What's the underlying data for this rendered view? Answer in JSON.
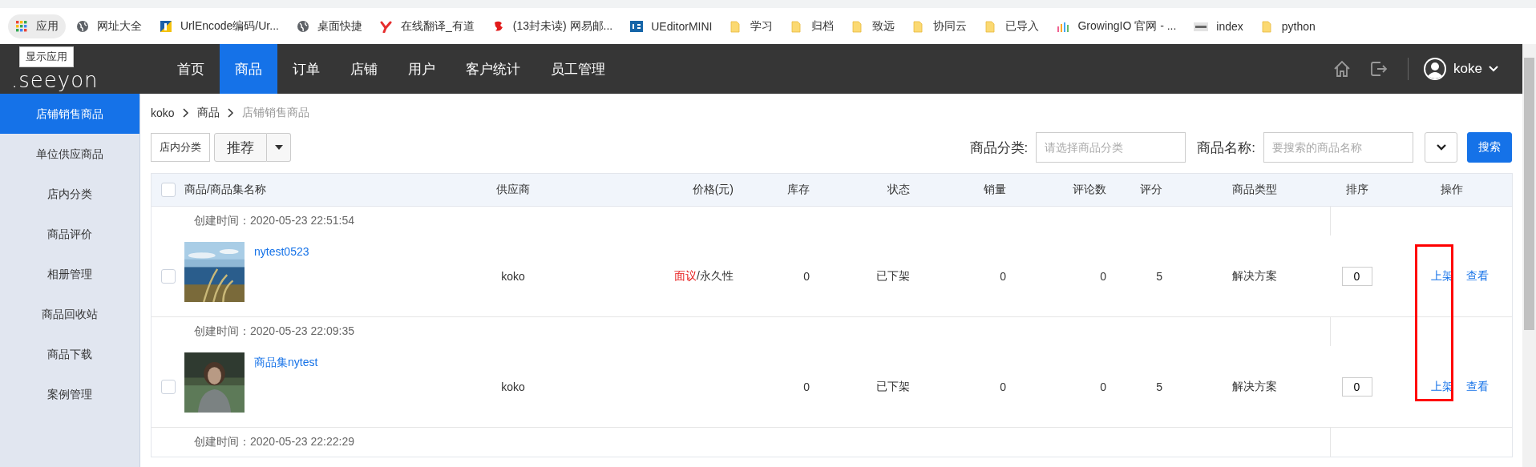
{
  "bookmarks": [
    {
      "label": "应用",
      "kind": "apps"
    },
    {
      "label": "网址大全",
      "kind": "globe"
    },
    {
      "label": "UrlEncode编码/Ur...",
      "kind": "encode"
    },
    {
      "label": "桌面快捷",
      "kind": "globe"
    },
    {
      "label": "在线翻译_有道",
      "kind": "youdao"
    },
    {
      "label": "(13封未读) 网易邮...",
      "kind": "mail"
    },
    {
      "label": "UEditorMINI",
      "kind": "ue"
    },
    {
      "label": "学习",
      "kind": "folder"
    },
    {
      "label": "归档",
      "kind": "folder"
    },
    {
      "label": "致远",
      "kind": "folder"
    },
    {
      "label": "协同云",
      "kind": "folder"
    },
    {
      "label": "已导入",
      "kind": "folder"
    },
    {
      "label": "GrowingIO 官网 - ...",
      "kind": "bars"
    },
    {
      "label": "index",
      "kind": "tile"
    },
    {
      "label": "python",
      "kind": "folder"
    }
  ],
  "header": {
    "logo": ".seeyon",
    "tooltip": "显示应用",
    "nav": [
      {
        "label": "首页",
        "selected": false
      },
      {
        "label": "商品",
        "selected": true
      },
      {
        "label": "订单",
        "selected": false
      },
      {
        "label": "店铺",
        "selected": false
      },
      {
        "label": "用户",
        "selected": false
      },
      {
        "label": "客户统计",
        "selected": false
      },
      {
        "label": "员工管理",
        "selected": false
      }
    ],
    "user": "koke"
  },
  "sidebar": {
    "items": [
      {
        "label": "店铺销售商品",
        "selected": true
      },
      {
        "label": "单位供应商品",
        "selected": false
      },
      {
        "label": "店内分类",
        "selected": false
      },
      {
        "label": "商品评价",
        "selected": false
      },
      {
        "label": "相册管理",
        "selected": false
      },
      {
        "label": "商品回收站",
        "selected": false
      },
      {
        "label": "商品下载",
        "selected": false
      },
      {
        "label": "案例管理",
        "selected": false
      }
    ]
  },
  "breadcrumb": [
    "koko",
    "商品",
    "店铺销售商品"
  ],
  "toolbar": {
    "category_button": "店内分类",
    "recommend_button": "推荐"
  },
  "filters": {
    "category_label": "商品分类:",
    "category_placeholder": "请选择商品分类",
    "name_label": "商品名称:",
    "name_placeholder": "要搜索的商品名称",
    "search_button": "搜索"
  },
  "table": {
    "header_checked": false,
    "columns": [
      "商品/商品集名称",
      "供应商",
      "价格(元)",
      "库存",
      "状态",
      "销量",
      "评论数",
      "评分",
      "商品类型",
      "排序",
      "操作"
    ],
    "groups": [
      {
        "created": "创建时间：2020-05-23 22:51:54",
        "row": {
          "checked": false,
          "name": "nytest0523",
          "supplier": "koko",
          "price": "面议",
          "price_note": "/永久性",
          "stock": "0",
          "status": "已下架",
          "sales": "0",
          "comments": "0",
          "score": "5",
          "type": "解决方案",
          "order": "0",
          "actions": [
            "上架",
            "查看"
          ]
        }
      },
      {
        "created": "创建时间：2020-05-23 22:09:35",
        "row": {
          "checked": false,
          "name": "商品集nytest",
          "supplier": "koko",
          "stock": "0",
          "status": "已下架",
          "sales": "0",
          "comments": "0",
          "score": "5",
          "type": "解决方案",
          "order": "0",
          "actions": [
            "上架",
            "查看"
          ]
        }
      },
      {
        "created": "创建时间：2020-05-23 22:22:29"
      }
    ]
  },
  "highlight": {
    "kind": "frame",
    "color": "#ff0000"
  }
}
